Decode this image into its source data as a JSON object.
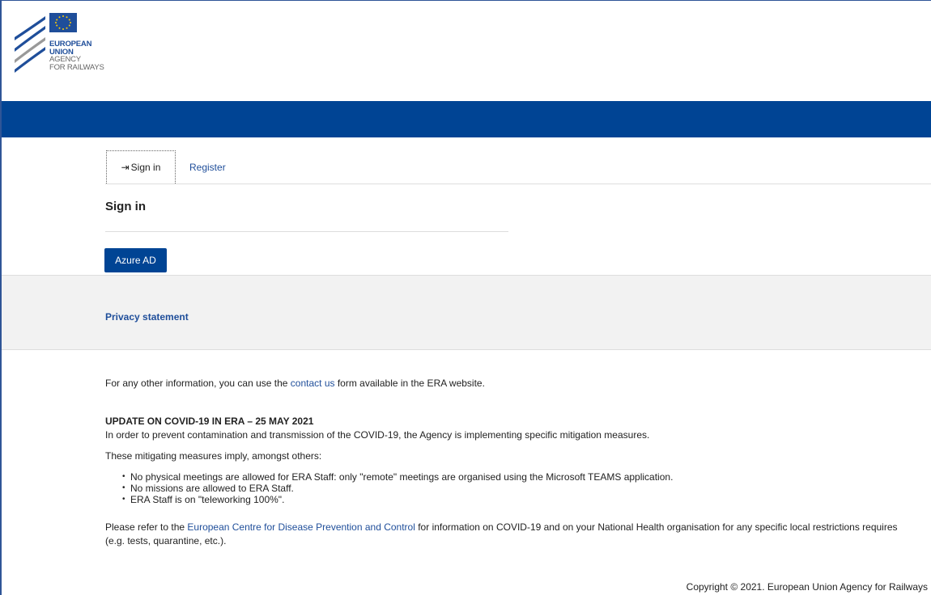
{
  "brand": {
    "line1": "EUROPEAN",
    "line2": "UNION",
    "line3": "AGENCY",
    "line4": "FOR RAILWAYS",
    "colors": {
      "primary": "#004494",
      "eu_flag": "#1f4e9a",
      "stars": "#ffcc00"
    }
  },
  "tabs": {
    "signin_icon": "sign-in-icon",
    "signin_label": "Sign in",
    "register_label": "Register"
  },
  "signin": {
    "title": "Sign in",
    "azure_button": "Azure AD"
  },
  "privacy": {
    "link": "Privacy statement"
  },
  "info": {
    "contact_prefix": "For any other information, you can use the ",
    "contact_link": "contact us",
    "contact_suffix": " form available in the ERA website.",
    "covid_title": "UPDATE ON COVID-19 IN ERA – 25 MAY 2021",
    "covid_p1": "In order to prevent contamination and transmission of the COVID-19, the Agency is implementing specific mitigation measures.",
    "covid_p2": "These mitigating measures imply, amongst others:",
    "bullets": [
      "No physical meetings are allowed for ERA Staff: only \"remote\" meetings are organised using the Microsoft TEAMS application.",
      "No missions are allowed to ERA Staff.",
      "ERA Staff is on \"teleworking 100%\"."
    ],
    "ecdc_prefix": "Please refer to the ",
    "ecdc_link": "European Centre for Disease Prevention and Control",
    "ecdc_suffix": " for information on COVID-19 and on your National Health organisation for any specific local restrictions requires (e.g. tests, quarantine, etc.)."
  },
  "footer": {
    "copyright": "Copyright © 2021. European Union Agency for Railways"
  }
}
